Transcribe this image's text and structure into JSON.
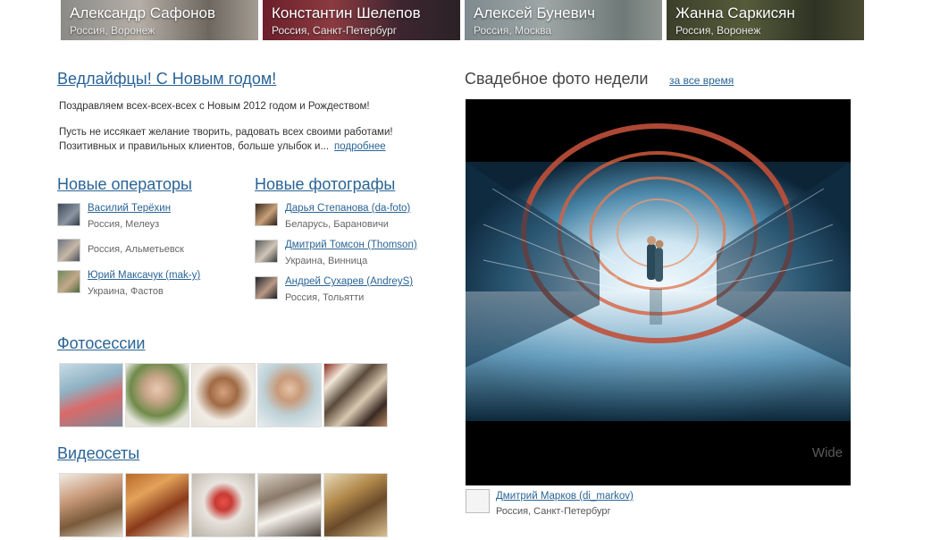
{
  "top_photographers": [
    {
      "name": "Александр Сафонов",
      "location": "Россия, Воронеж"
    },
    {
      "name": "Константин Шелепов",
      "location": "Россия, Санкт-Петербург"
    },
    {
      "name": "Алексей Буневич",
      "location": "Россия, Москва"
    },
    {
      "name": "Жанна Саркисян",
      "location": "Россия, Воронеж"
    }
  ],
  "news": {
    "title": "Ведлайфцы! С Новым годом!",
    "line1": "Поздравляем всех-всех-всех с Новым 2012 годом и Рождеством!",
    "line2": "Пусть не иссякает желание творить, радовать всех своими работами!",
    "line3": "Позитивных и правильных клиентов, больше улыбок и...",
    "more": "подробнее"
  },
  "new_operators": {
    "title": "Новые операторы",
    "items": [
      {
        "name": "Василий Терёхин",
        "location": "Россия, Мелеуз"
      },
      {
        "name": "",
        "location": "Россия, Альметьевск"
      },
      {
        "name": "Юрий Максачук (mak-y)",
        "location": "Украина, Фастов"
      }
    ]
  },
  "new_photographers": {
    "title": "Новые фотографы",
    "items": [
      {
        "name": "Дарья Степанова (da-foto)",
        "location": "Беларусь, Барановичи"
      },
      {
        "name": "Дмитрий Томсон (Thomson)",
        "location": "Украина, Винница"
      },
      {
        "name": "Андрей Сухарев (AndreyS)",
        "location": "Россия, Тольятти"
      }
    ]
  },
  "photosessions": {
    "title": "Фотосессии"
  },
  "videosets": {
    "title": "Видеосеты"
  },
  "wedding_photo": {
    "title": "Свадебное фото недели",
    "all_time": "за все время",
    "watermark": "Wide",
    "author_name": "Дмитрий Марков (di_markov)",
    "author_location": "Россия, Санкт-Петербург"
  },
  "colors": {
    "link": "#2a6496",
    "text": "#333333",
    "photo_bg": "#000000"
  }
}
